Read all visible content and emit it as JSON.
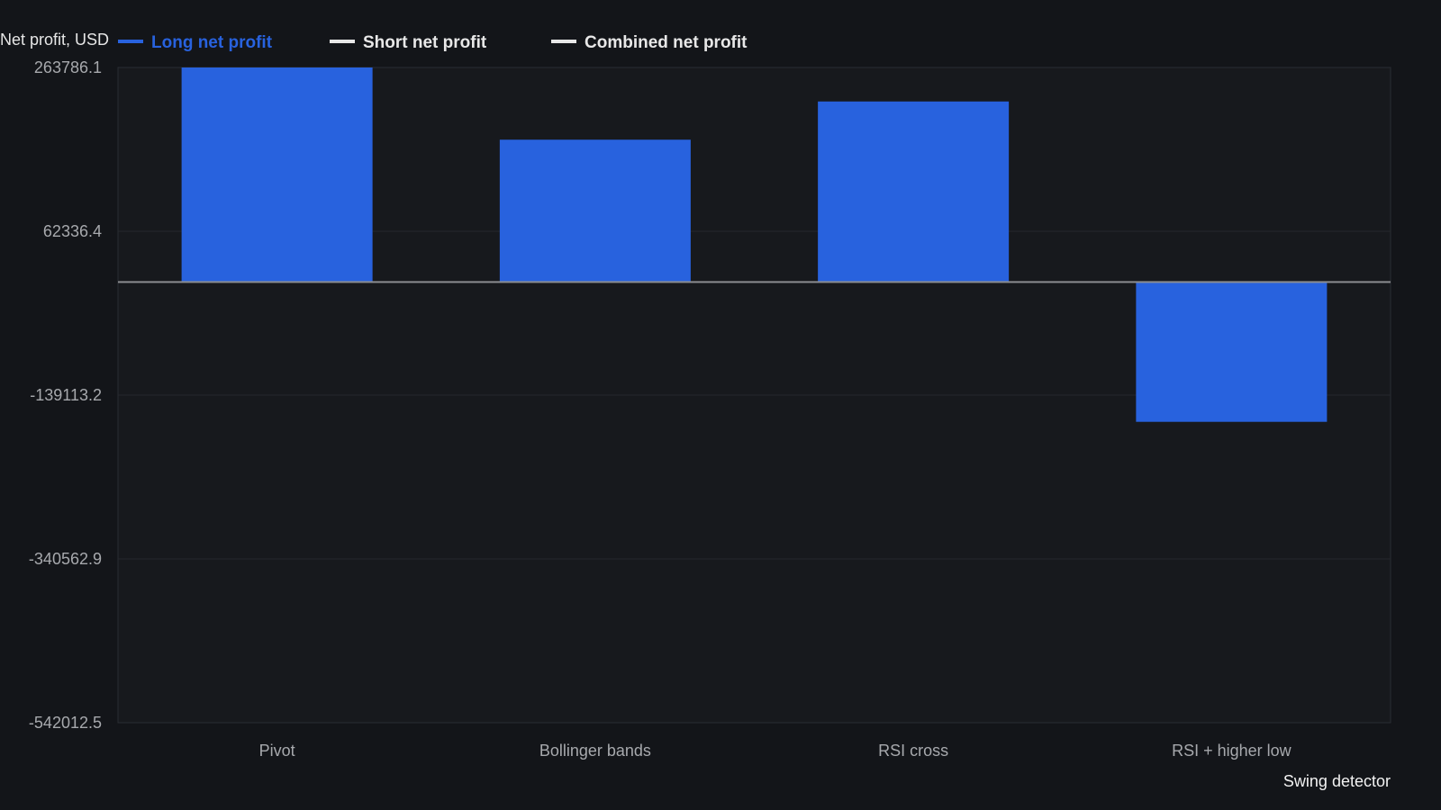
{
  "chart_data": {
    "type": "bar",
    "ylabel": "Net profit, USD",
    "xlabel": "Swing detector",
    "categories": [
      "Pivot",
      "Bollinger bands",
      "RSI cross",
      "RSI + higher low"
    ],
    "series": [
      {
        "name": "Long net profit",
        "values": [
          263786.1,
          175000,
          222000,
          -172000
        ],
        "color": "#2862de"
      },
      {
        "name": "Short net profit",
        "values": [],
        "color": "#e8e8e8"
      },
      {
        "name": "Combined net profit",
        "values": [],
        "color": "#e8e8e8"
      }
    ],
    "ylim": [
      -542012.5,
      263786.1
    ],
    "yticks": [
      "263786.1",
      "62336.4",
      "-139113.2",
      "-340562.9",
      "-542012.5"
    ],
    "ytick_values": [
      263786.1,
      62336.4,
      -139113.2,
      -340562.9,
      -542012.5
    ],
    "grid": true,
    "legend_position": "top-left",
    "colors": {
      "background": "#131519",
      "plot_background": "#17191d",
      "grid": "#25282d",
      "zero_line": "#8a8c90",
      "tick_text": "#a7a9ad"
    }
  }
}
